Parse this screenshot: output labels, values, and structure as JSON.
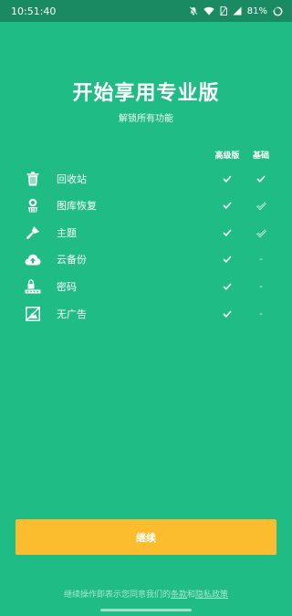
{
  "status_bar": {
    "time": "10:51:40",
    "battery_percent": "81%",
    "icons": [
      "mute-icon",
      "wifi-icon",
      "sim-icon",
      "signal-icon",
      "battery-icon"
    ]
  },
  "header": {
    "title": "开始享用专业版",
    "subtitle": "解锁所有功能"
  },
  "columns": {
    "pro": "高级版",
    "basic": "基础"
  },
  "features": [
    {
      "label": "回收站",
      "icon": "trash-icon",
      "pro": "check",
      "basic": "check"
    },
    {
      "label": "图库恢复",
      "icon": "gallery-restore-icon",
      "pro": "check",
      "basic": "check-outline"
    },
    {
      "label": "主题",
      "icon": "brush-icon",
      "pro": "check",
      "basic": "check-outline"
    },
    {
      "label": "云备份",
      "icon": "cloud-upload-icon",
      "pro": "check",
      "basic": "-"
    },
    {
      "label": "密码",
      "icon": "password-icon",
      "pro": "check",
      "basic": "-"
    },
    {
      "label": "无广告",
      "icon": "no-ads-icon",
      "pro": "check",
      "basic": "-"
    }
  ],
  "continue_label": "继续",
  "terms": {
    "prefix": "继续操作即表示您同意我们的",
    "terms_link": "条款",
    "conjunction": "和",
    "privacy_link": "隐私政策"
  },
  "colors": {
    "background": "#1fbd85",
    "status_bar": "#1a8a63",
    "button": "#fbbd2e"
  }
}
